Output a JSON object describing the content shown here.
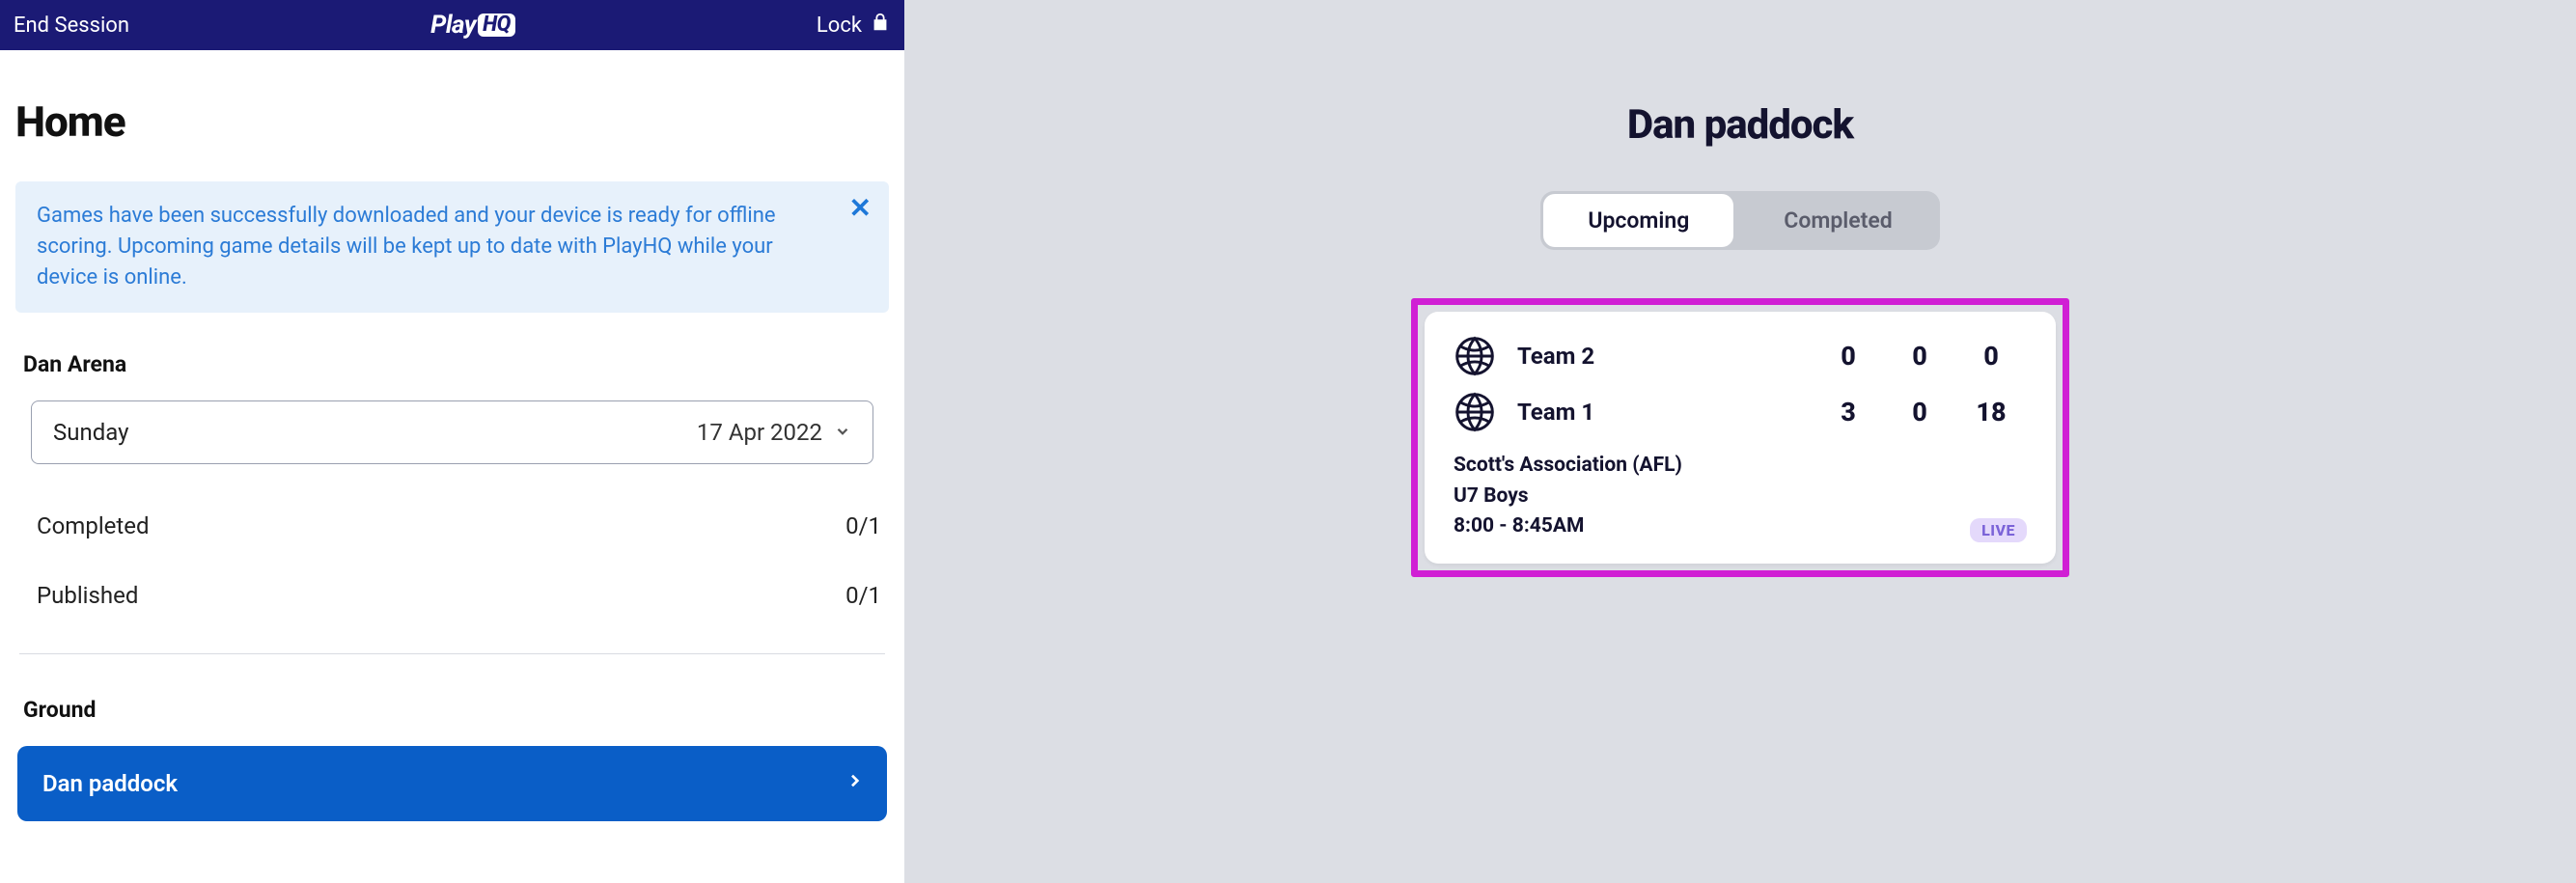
{
  "header": {
    "end_session": "End Session",
    "brand_play": "Play",
    "brand_hq": "HQ",
    "lock": "Lock"
  },
  "home": {
    "title": "Home",
    "banner": "Games have been successfully downloaded and your device is ready for offline scoring. Upcoming game details will be kept up to date with PlayHQ while your device is online.",
    "arena_label": "Dan Arena",
    "day": "Sunday",
    "date": "17 Apr 2022",
    "completed_label": "Completed",
    "completed_value": "0/1",
    "published_label": "Published",
    "published_value": "0/1",
    "ground_label": "Ground",
    "ground_button": "Dan paddock"
  },
  "right": {
    "title": "Dan paddock",
    "tab_upcoming": "Upcoming",
    "tab_completed": "Completed",
    "game": {
      "team_a": "Team 2",
      "a_s1": "0",
      "a_s2": "0",
      "a_s3": "0",
      "team_b": "Team 1",
      "b_s1": "3",
      "b_s2": "0",
      "b_s3": "18",
      "assoc": "Scott's Association (AFL)",
      "grade": "U7 Boys",
      "time": "8:00 - 8:45AM",
      "badge": "LIVE"
    }
  }
}
